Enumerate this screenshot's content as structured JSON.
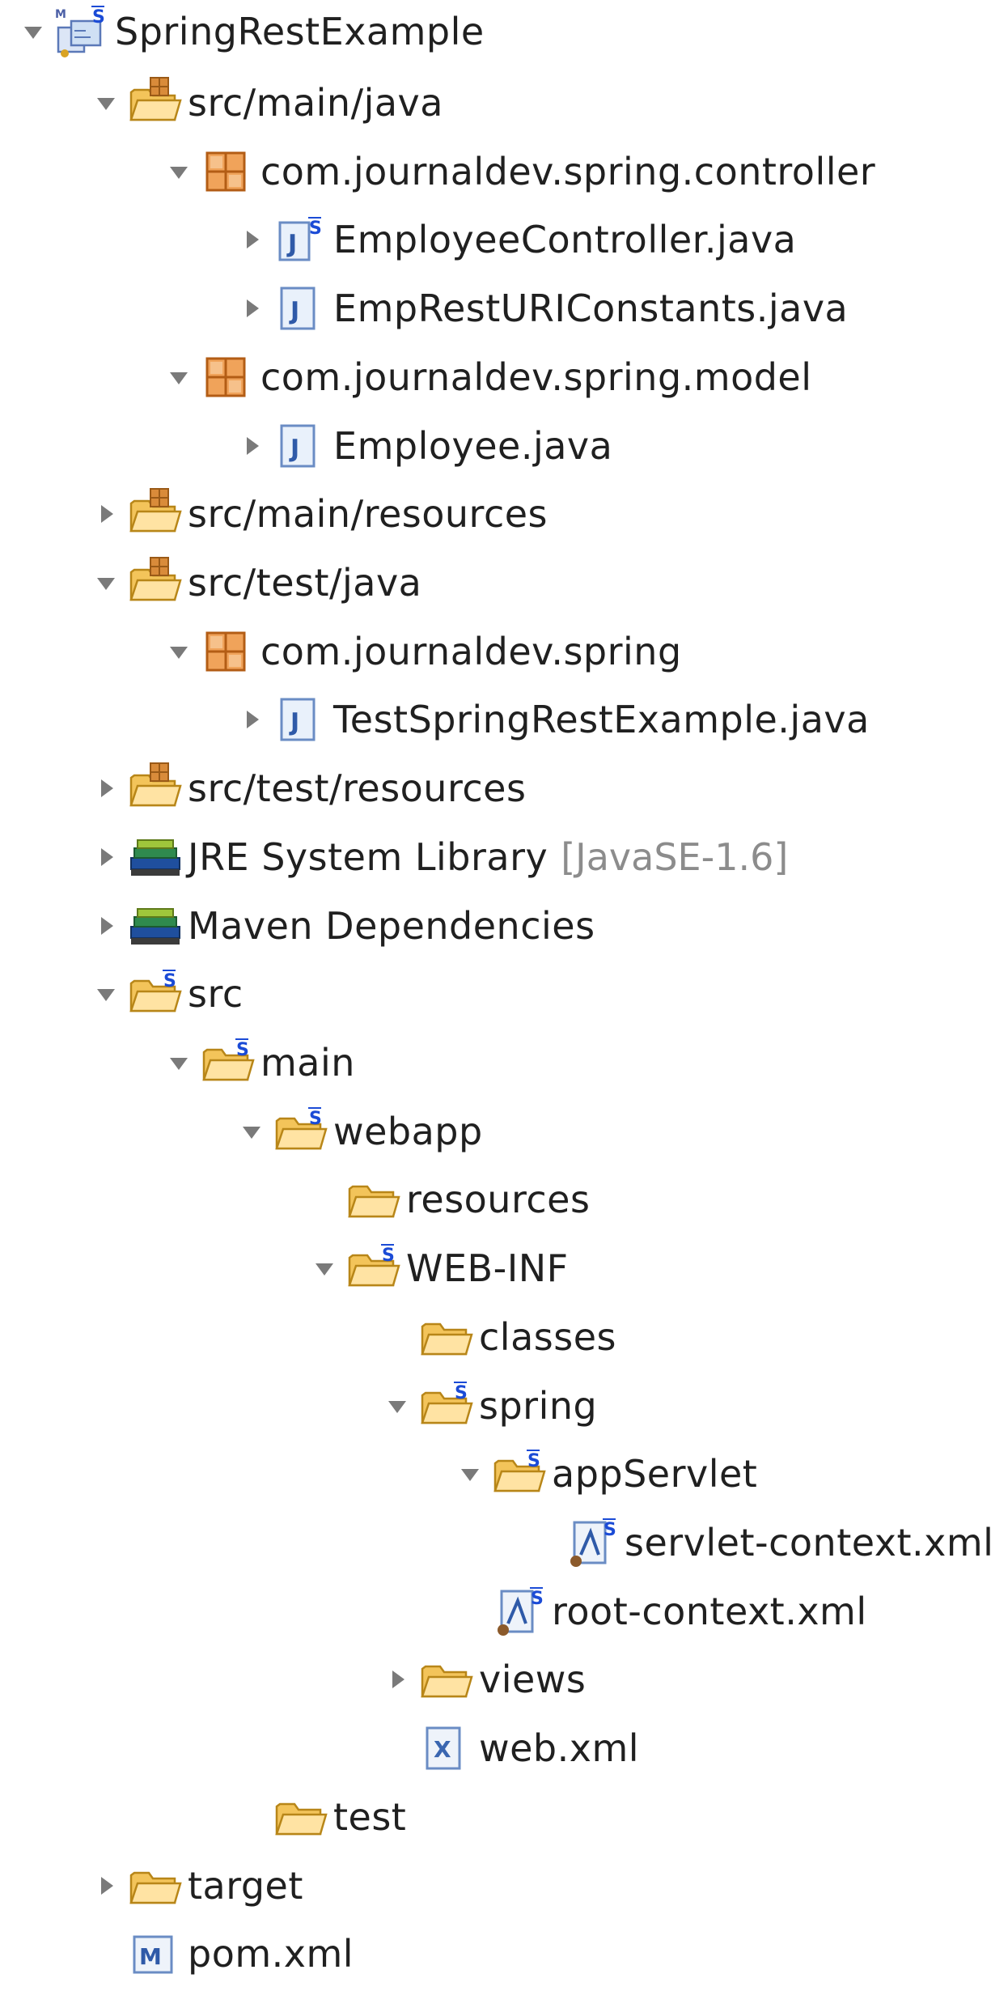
{
  "project_explorer": {
    "items": [
      {
        "label": "SpringRestExample",
        "icon": "spring-maven-project-icon",
        "twisty": "expanded"
      },
      {
        "label": "src/main/java",
        "icon": "source-folder-icon",
        "twisty": "expanded"
      },
      {
        "label": "com.journaldev.spring.controller",
        "icon": "package-icon",
        "twisty": "expanded"
      },
      {
        "label": "EmployeeController.java",
        "icon": "spring-java-file-icon",
        "twisty": "collapsed"
      },
      {
        "label": "EmpRestURIConstants.java",
        "icon": "java-file-icon",
        "twisty": "collapsed"
      },
      {
        "label": "com.journaldev.spring.model",
        "icon": "package-icon",
        "twisty": "expanded"
      },
      {
        "label": "Employee.java",
        "icon": "java-file-icon",
        "twisty": "collapsed"
      },
      {
        "label": "src/main/resources",
        "icon": "source-folder-icon",
        "twisty": "collapsed"
      },
      {
        "label": "src/test/java",
        "icon": "source-folder-icon",
        "twisty": "expanded"
      },
      {
        "label": "com.journaldev.spring",
        "icon": "package-icon",
        "twisty": "expanded"
      },
      {
        "label": "TestSpringRestExample.java",
        "icon": "java-file-icon",
        "twisty": "collapsed"
      },
      {
        "label": "src/test/resources",
        "icon": "source-folder-icon",
        "twisty": "collapsed"
      },
      {
        "label": "JRE System Library",
        "decor": "[JavaSE-1.6]",
        "icon": "library-icon",
        "twisty": "collapsed"
      },
      {
        "label": "Maven Dependencies",
        "icon": "library-icon",
        "twisty": "collapsed"
      },
      {
        "label": "src",
        "icon": "spring-folder-icon",
        "twisty": "expanded"
      },
      {
        "label": "main",
        "icon": "spring-folder-icon",
        "twisty": "expanded"
      },
      {
        "label": "webapp",
        "icon": "spring-folder-icon",
        "twisty": "expanded"
      },
      {
        "label": "resources",
        "icon": "folder-icon",
        "twisty": "none"
      },
      {
        "label": "WEB-INF",
        "icon": "spring-folder-icon",
        "twisty": "expanded"
      },
      {
        "label": "classes",
        "icon": "folder-icon",
        "twisty": "none"
      },
      {
        "label": "spring",
        "icon": "spring-folder-icon",
        "twisty": "expanded"
      },
      {
        "label": "appServlet",
        "icon": "spring-folder-icon",
        "twisty": "expanded"
      },
      {
        "label": "servlet-context.xml",
        "icon": "spring-bean-xml-icon",
        "twisty": "none"
      },
      {
        "label": "root-context.xml",
        "icon": "spring-bean-xml-icon",
        "twisty": "none"
      },
      {
        "label": "views",
        "icon": "folder-icon",
        "twisty": "collapsed"
      },
      {
        "label": "web.xml",
        "icon": "xml-file-icon",
        "twisty": "none"
      },
      {
        "label": "test",
        "icon": "folder-icon",
        "twisty": "none"
      },
      {
        "label": "target",
        "icon": "folder-icon",
        "twisty": "collapsed"
      },
      {
        "label": "pom.xml",
        "icon": "maven-pom-icon",
        "twisty": "none"
      }
    ]
  }
}
